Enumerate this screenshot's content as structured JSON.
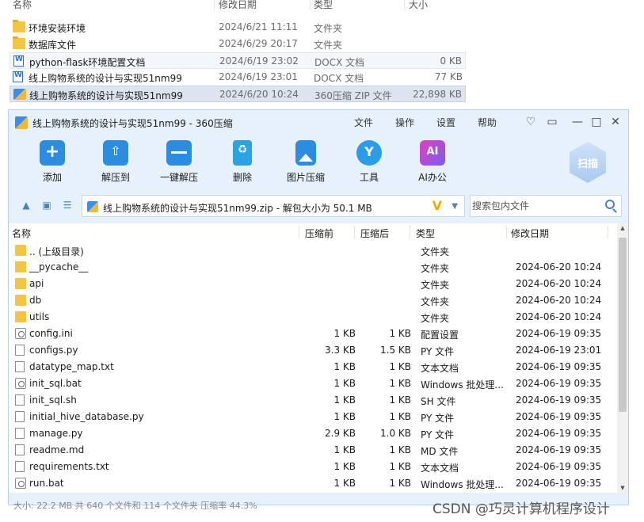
{
  "explorer": {
    "headers": {
      "name": "名称",
      "date": "修改日期",
      "type": "类型",
      "size": "大小"
    },
    "rows": [
      {
        "name": "环境安装环境",
        "date": "2024/6/21 11:11",
        "type": "文件夹",
        "size": "",
        "icon": "folder-icon"
      },
      {
        "name": "数据库文件",
        "date": "2024/6/29 20:17",
        "type": "文件夹",
        "size": "",
        "icon": "folder-icon"
      },
      {
        "name": "python-flask环境配置文档",
        "date": "2024/6/19 23:02",
        "type": "DOCX 文档",
        "size": "0 KB",
        "icon": "word-doc-icon"
      },
      {
        "name": "线上购物系统的设计与实现51nm99",
        "date": "2024/6/19 23:01",
        "type": "DOCX 文档",
        "size": "77 KB",
        "icon": "word-doc-icon"
      },
      {
        "name": "线上购物系统的设计与实现51nm99",
        "date": "2024/6/20 10:24",
        "type": "360压缩 ZIP 文件",
        "size": "22,898 KB",
        "icon": "zip-archive-icon"
      }
    ]
  },
  "window": {
    "title": "线上购物系统的设计与实现51nm99 - 360压缩",
    "menu": [
      "文件",
      "操作",
      "设置",
      "帮助"
    ],
    "toolbar": [
      {
        "label": "添加",
        "color": "#2b8ce0"
      },
      {
        "label": "解压到",
        "color": "#2b8ce0"
      },
      {
        "label": "一键解压",
        "color": "#2b8ce0"
      },
      {
        "label": "删除",
        "color": "#2aa3e0"
      },
      {
        "label": "图片压缩",
        "color": "#2b8ce0"
      },
      {
        "label": "工具",
        "color": "#2b9ce8"
      },
      {
        "label": "AI办公",
        "color": "#c13fe0"
      }
    ],
    "scan_label": "扫描",
    "path": "线上购物系统的设计与实现51nm99.zip - 解包大小为 50.1 MB",
    "search_placeholder": "搜索包内文件",
    "columns": {
      "name": "名称",
      "compressed": "压缩前",
      "uncompressed": "压缩后",
      "type": "类型",
      "date": "修改日期"
    },
    "files": [
      {
        "name": ".. (上级目录)",
        "cs": "",
        "us": "",
        "type": "文件夹",
        "date": "",
        "kind": "folder"
      },
      {
        "name": "__pycache__",
        "cs": "",
        "us": "",
        "type": "文件夹",
        "date": "2024-06-20 10:24",
        "kind": "folder"
      },
      {
        "name": "api",
        "cs": "",
        "us": "",
        "type": "文件夹",
        "date": "2024-06-20 10:24",
        "kind": "folder"
      },
      {
        "name": "db",
        "cs": "",
        "us": "",
        "type": "文件夹",
        "date": "2024-06-20 10:24",
        "kind": "folder"
      },
      {
        "name": "utils",
        "cs": "",
        "us": "",
        "type": "文件夹",
        "date": "2024-06-20 10:24",
        "kind": "folder"
      },
      {
        "name": "config.ini",
        "cs": "1 KB",
        "us": "1 KB",
        "type": "配置设置",
        "date": "2024-06-19 09:35",
        "kind": "gear"
      },
      {
        "name": "configs.py",
        "cs": "3.3 KB",
        "us": "1.5 KB",
        "type": "PY 文件",
        "date": "2024-06-19 23:01",
        "kind": "text"
      },
      {
        "name": "datatype_map.txt",
        "cs": "1 KB",
        "us": "1 KB",
        "type": "文本文档",
        "date": "2024-06-19 09:35",
        "kind": "text"
      },
      {
        "name": "init_sql.bat",
        "cs": "1 KB",
        "us": "1 KB",
        "type": "Windows 批处理...",
        "date": "2024-06-19 09:35",
        "kind": "gear"
      },
      {
        "name": "init_sql.sh",
        "cs": "1 KB",
        "us": "1 KB",
        "type": "SH 文件",
        "date": "2024-06-19 09:35",
        "kind": "text"
      },
      {
        "name": "initial_hive_database.py",
        "cs": "1 KB",
        "us": "1 KB",
        "type": "PY 文件",
        "date": "2024-06-19 09:35",
        "kind": "text"
      },
      {
        "name": "manage.py",
        "cs": "2.9 KB",
        "us": "1.0 KB",
        "type": "PY 文件",
        "date": "2024-06-19 09:35",
        "kind": "text"
      },
      {
        "name": "readme.md",
        "cs": "1 KB",
        "us": "1 KB",
        "type": "MD 文件",
        "date": "2024-06-19 09:35",
        "kind": "text"
      },
      {
        "name": "requirements.txt",
        "cs": "1 KB",
        "us": "1 KB",
        "type": "文本文档",
        "date": "2024-06-19 09:35",
        "kind": "text"
      },
      {
        "name": "run.bat",
        "cs": "1 KB",
        "us": "1 KB",
        "type": "Windows 批处理...",
        "date": "2024-06-19 09:35",
        "kind": "gear"
      }
    ],
    "status": "大小: 22.2 MB 共 640 个文件和 114 个文件夹 压缩率 44.3%"
  },
  "watermark": "CSDN @巧灵计算机程序设计"
}
